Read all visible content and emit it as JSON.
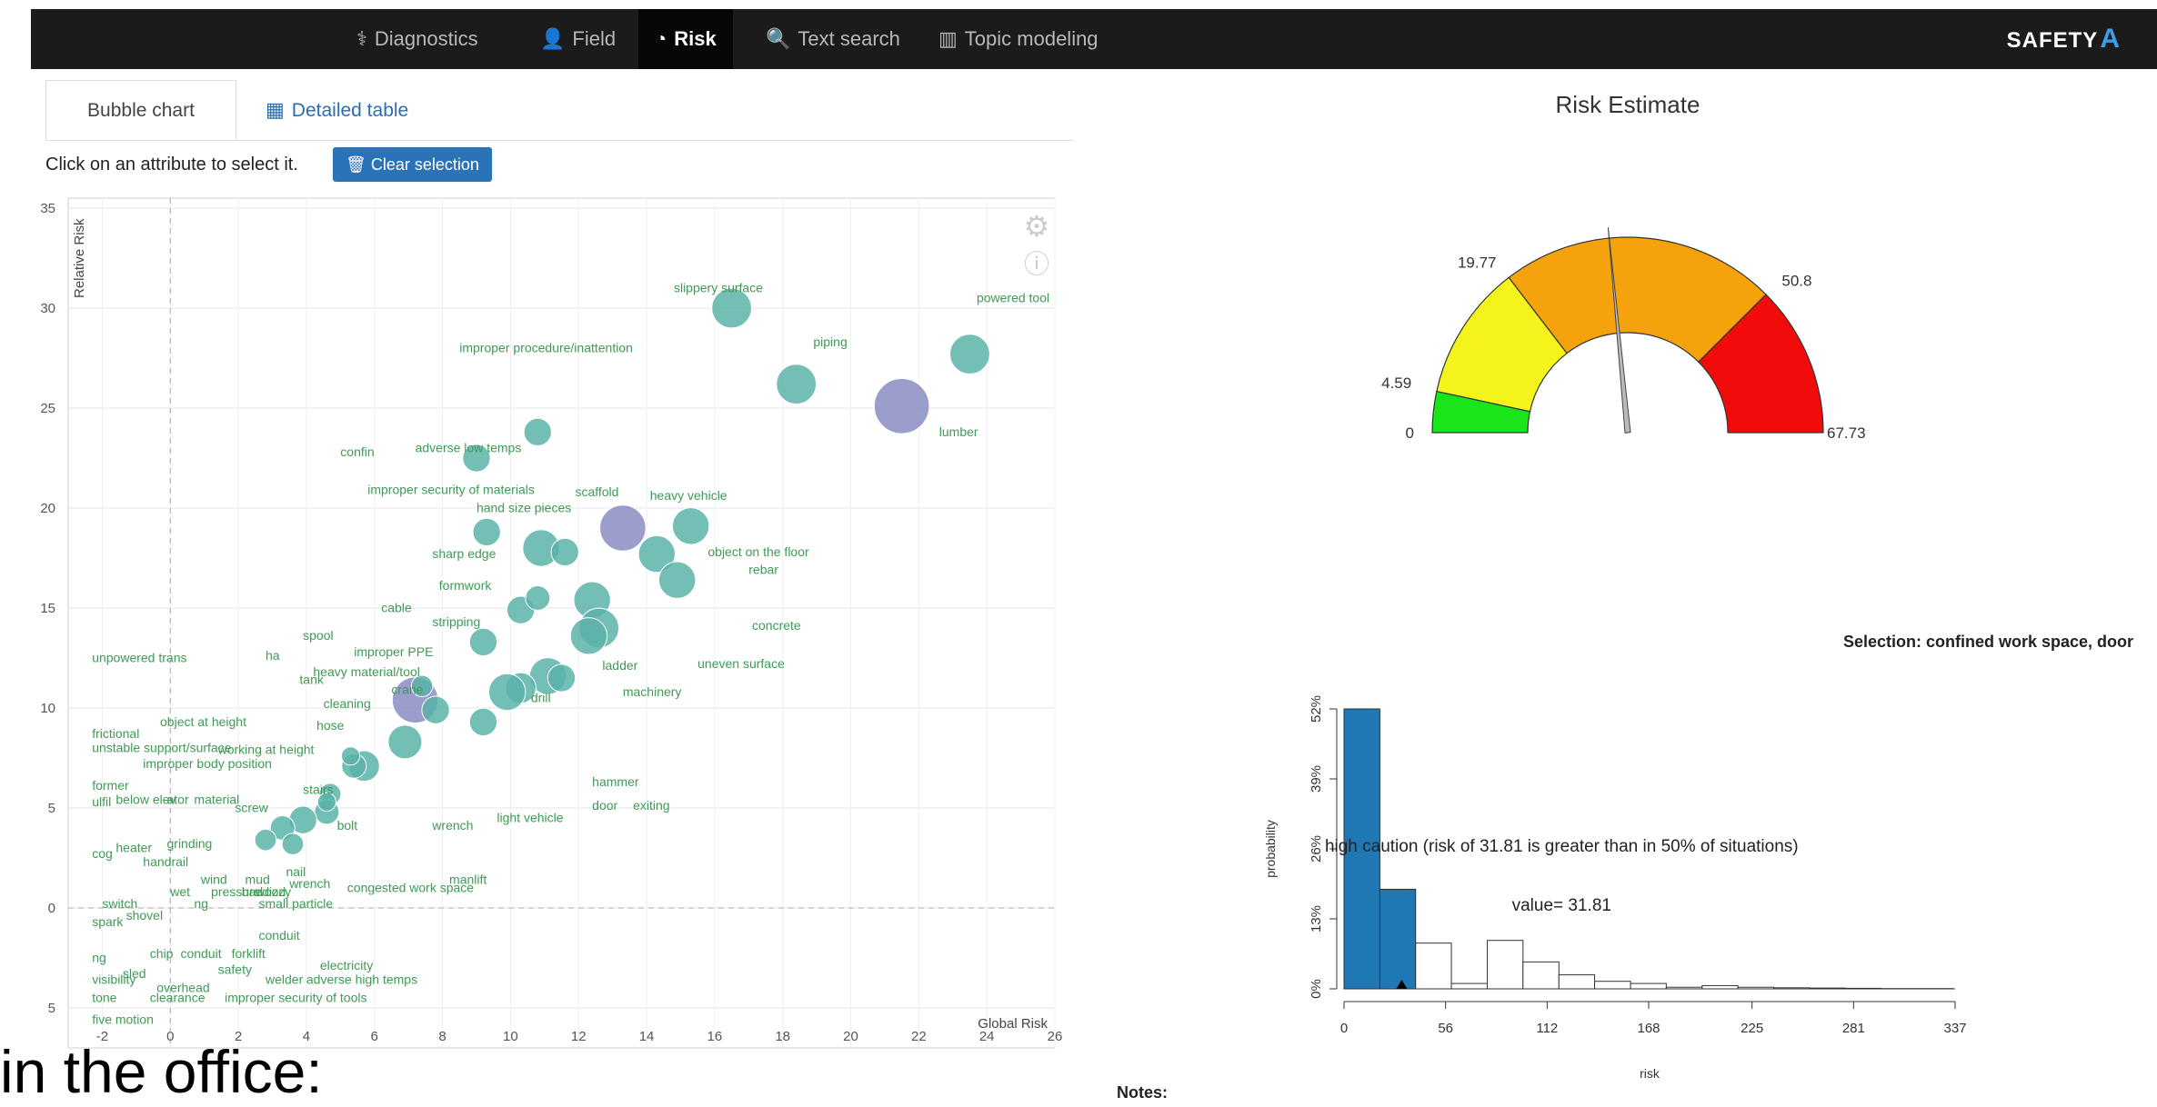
{
  "nav": {
    "items": [
      {
        "label": "Diagnostics",
        "icon": "stethoscope-icon",
        "glyph": "⚕"
      },
      {
        "label": "Field",
        "icon": "user-icon",
        "glyph": "👤"
      },
      {
        "label": "Risk",
        "icon": "dashboard-icon",
        "glyph": "◔",
        "active": true
      },
      {
        "label": "Text search",
        "icon": "search-icon",
        "glyph": "🔍"
      },
      {
        "label": "Topic modeling",
        "icon": "bar-chart-icon",
        "glyph": "▥"
      }
    ],
    "brand": "SAFETY",
    "brand_mark": "A"
  },
  "tabs": [
    {
      "label": "Bubble chart",
      "active": true
    },
    {
      "label": "Detailed table",
      "icon": "table-icon",
      "glyph": "▦"
    }
  ],
  "hint": "Click on an attribute to select it.",
  "clear_button": {
    "label": "Clear selection",
    "glyph": "🗑"
  },
  "risk_title": "Risk Estimate",
  "selection_text": "Selection: confined work space, door",
  "notes_label": "Notes:",
  "overlay_text": "in the office:",
  "colors": {
    "bubble_teal": "#5bb3a8",
    "bubble_purple": "#8a8cc1",
    "label_green": "#3f9a56",
    "gauge_green": "#19e619",
    "gauge_yellow": "#f4f41c",
    "gauge_orange": "#f5a20c",
    "gauge_red": "#f20b0b",
    "hist_blue": "#1f77b4"
  },
  "chart_data": [
    {
      "type": "scatter",
      "xlabel": "Global Risk",
      "ylabel": "Relative Risk",
      "xlim": [
        -3,
        26
      ],
      "ylim": [
        -7,
        35.5
      ],
      "x_ticks": [
        -2,
        0,
        2,
        4,
        6,
        8,
        10,
        12,
        14,
        16,
        18,
        20,
        22,
        24,
        26
      ],
      "x_tick_labels": [
        "-2",
        "0",
        "2",
        "4",
        "6",
        "8",
        "10",
        "12",
        "14",
        "16",
        "18",
        "20",
        "22",
        "24",
        "26"
      ],
      "y_ticks": [
        35,
        30,
        25,
        20,
        15,
        10,
        5,
        0,
        -5
      ],
      "y_tick_labels": [
        "35",
        "30",
        "25",
        "20",
        "15",
        "10",
        "5",
        "0",
        "5"
      ],
      "points": [
        {
          "label": "slippery surface",
          "x": 16.5,
          "y": 30,
          "r": 1.3,
          "c": "teal"
        },
        {
          "label": "powered tool",
          "x": 23.5,
          "y": 27.7,
          "r": 1.3,
          "c": "teal"
        },
        {
          "label": "piping",
          "x": 18.4,
          "y": 26.2,
          "r": 1.3,
          "c": "teal"
        },
        {
          "label": "lumber",
          "x": 21.5,
          "y": 25.1,
          "r": 1.8,
          "c": "purple"
        },
        {
          "label": "improper procedure/inattention",
          "x": 10.8,
          "y": 23.8,
          "r": 0.9,
          "c": "teal"
        },
        {
          "label": "adverse low temps",
          "x": 9.0,
          "y": 22.5,
          "r": 0.9,
          "c": "teal"
        },
        {
          "label": "scaffold",
          "x": 13.3,
          "y": 19.0,
          "r": 1.5,
          "c": "purple"
        },
        {
          "label": "heavy vehicle",
          "x": 15.3,
          "y": 19.1,
          "r": 1.2,
          "c": "teal"
        },
        {
          "label": "object on the floor",
          "x": 14.3,
          "y": 17.7,
          "r": 1.2,
          "c": "teal"
        },
        {
          "label": "rebar",
          "x": 14.9,
          "y": 16.4,
          "r": 1.2,
          "c": "teal"
        },
        {
          "label": "improper security of materials",
          "x": 9.3,
          "y": 18.8,
          "r": 0.9,
          "c": "teal"
        },
        {
          "label": "hand size pieces",
          "x": 10.9,
          "y": 18.0,
          "r": 1.2,
          "c": "teal"
        },
        {
          "label": "sharp edge",
          "x": 11.6,
          "y": 17.8,
          "r": 0.9,
          "c": "teal"
        },
        {
          "label": "concrete",
          "x": 12.4,
          "y": 15.4,
          "r": 1.2,
          "c": "teal"
        },
        {
          "label": "formwork",
          "x": 10.3,
          "y": 14.9,
          "r": 0.9,
          "c": "teal"
        },
        {
          "label": "cable",
          "x": 10.8,
          "y": 15.5,
          "r": 0.8,
          "c": "teal"
        },
        {
          "label": "ladder",
          "x": 12.6,
          "y": 14.0,
          "r": 1.3,
          "c": "teal"
        },
        {
          "label": "uneven surface",
          "x": 12.3,
          "y": 13.6,
          "r": 1.2,
          "c": "teal"
        },
        {
          "label": "stripping",
          "x": 9.2,
          "y": 13.3,
          "r": 0.9,
          "c": "teal"
        },
        {
          "label": "machinery",
          "x": 11.1,
          "y": 11.6,
          "r": 1.2,
          "c": "teal"
        },
        {
          "label": "drill",
          "x": 10.3,
          "y": 11.0,
          "r": 1.0,
          "c": "teal"
        },
        {
          "label": "hammer",
          "x": 9.9,
          "y": 10.8,
          "r": 1.2,
          "c": "teal"
        },
        {
          "label": "door",
          "x": 11.5,
          "y": 11.5,
          "r": 0.9,
          "c": "teal"
        },
        {
          "label": "exiting",
          "x": 9.2,
          "y": 9.3,
          "r": 0.9,
          "c": "teal"
        },
        {
          "label": "confined work space",
          "x": 7.2,
          "y": 10.4,
          "r": 1.5,
          "c": "purple"
        },
        {
          "label": "crane",
          "x": 7.8,
          "y": 9.9,
          "r": 0.9,
          "c": "teal"
        },
        {
          "label": "light vehicle",
          "x": 6.9,
          "y": 8.3,
          "r": 1.1,
          "c": "teal"
        },
        {
          "label": "heavy material/tool",
          "x": 7.4,
          "y": 11.1,
          "r": 0.7,
          "c": "teal"
        },
        {
          "label": "cleaning",
          "x": 5.7,
          "y": 7.1,
          "r": 1.0,
          "c": "teal"
        },
        {
          "label": "wrench",
          "x": 5.4,
          "y": 7.1,
          "r": 0.8,
          "c": "teal"
        },
        {
          "label": "stairs",
          "x": 4.7,
          "y": 5.7,
          "r": 0.7,
          "c": "teal"
        },
        {
          "label": "bolt",
          "x": 4.6,
          "y": 4.8,
          "r": 0.8,
          "c": "teal"
        },
        {
          "label": "nail",
          "x": 3.9,
          "y": 4.4,
          "r": 0.9,
          "c": "teal"
        },
        {
          "label": "screw",
          "x": 3.3,
          "y": 4.0,
          "r": 0.8,
          "c": "teal"
        },
        {
          "label": "grinding",
          "x": 2.8,
          "y": 3.4,
          "r": 0.7,
          "c": "teal"
        },
        {
          "label": "mud",
          "x": 3.6,
          "y": 3.2,
          "r": 0.7,
          "c": "teal"
        },
        {
          "label": "working at height",
          "x": 5.3,
          "y": 7.6,
          "r": 0.6,
          "c": "teal"
        },
        {
          "label": "object at height",
          "x": 4.6,
          "y": 5.3,
          "r": 0.6,
          "c": "teal"
        }
      ],
      "small_labels": [
        {
          "text": "slippery surface",
          "x": 14.8,
          "y": 30.8
        },
        {
          "text": "powered tool",
          "x": 23.7,
          "y": 30.3
        },
        {
          "text": "piping",
          "x": 18.9,
          "y": 28.1
        },
        {
          "text": "lumber",
          "x": 22.6,
          "y": 23.6
        },
        {
          "text": "improper procedure/inattention",
          "x": 8.5,
          "y": 27.8
        },
        {
          "text": "confin",
          "x": 5.0,
          "y": 22.6
        },
        {
          "text": "adverse low temps",
          "x": 7.2,
          "y": 22.8
        },
        {
          "text": "improper security of materials",
          "x": 5.8,
          "y": 20.7
        },
        {
          "text": "hand size pieces",
          "x": 9.0,
          "y": 19.8
        },
        {
          "text": "scaffold",
          "x": 11.9,
          "y": 20.6
        },
        {
          "text": "heavy vehicle",
          "x": 14.1,
          "y": 20.4
        },
        {
          "text": "sharp edge",
          "x": 7.7,
          "y": 17.5
        },
        {
          "text": "object on the floor",
          "x": 15.8,
          "y": 17.6
        },
        {
          "text": "rebar",
          "x": 17.0,
          "y": 16.7
        },
        {
          "text": "formwork",
          "x": 7.9,
          "y": 15.9
        },
        {
          "text": "cable",
          "x": 6.2,
          "y": 14.8
        },
        {
          "text": "stripping",
          "x": 7.7,
          "y": 14.1
        },
        {
          "text": "concrete",
          "x": 17.1,
          "y": 13.9
        },
        {
          "text": "spool",
          "x": 3.9,
          "y": 13.4
        },
        {
          "text": "improper PPE",
          "x": 5.4,
          "y": 12.6
        },
        {
          "text": "unpowered trans",
          "x": -2.3,
          "y": 12.3
        },
        {
          "text": "ha",
          "x": 2.8,
          "y": 12.4
        },
        {
          "text": "tank",
          "x": 3.8,
          "y": 11.2
        },
        {
          "text": "heavy material/tool",
          "x": 4.2,
          "y": 11.6
        },
        {
          "text": "ladder",
          "x": 12.7,
          "y": 11.9
        },
        {
          "text": "uneven surface",
          "x": 15.5,
          "y": 12.0
        },
        {
          "text": "crane",
          "x": 6.5,
          "y": 10.7
        },
        {
          "text": "machinery",
          "x": 13.3,
          "y": 10.6
        },
        {
          "text": "drill",
          "x": 10.6,
          "y": 10.3
        },
        {
          "text": "cleaning",
          "x": 4.5,
          "y": 10.0
        },
        {
          "text": "object at height",
          "x": -0.3,
          "y": 9.1
        },
        {
          "text": "hose",
          "x": 4.3,
          "y": 8.9
        },
        {
          "text": "frictional",
          "x": -2.3,
          "y": 8.5
        },
        {
          "text": "unstable support/surface",
          "x": -2.3,
          "y": 7.8
        },
        {
          "text": "working at height",
          "x": 1.4,
          "y": 7.7
        },
        {
          "text": "improper body position",
          "x": -0.8,
          "y": 7.0
        },
        {
          "text": "former",
          "x": -2.3,
          "y": 5.9
        },
        {
          "text": "stairs",
          "x": 3.9,
          "y": 5.7
        },
        {
          "text": "ulfil",
          "x": -2.3,
          "y": 5.1
        },
        {
          "text": "below elev",
          "x": -1.6,
          "y": 5.2
        },
        {
          "text": "ator",
          "x": -0.1,
          "y": 5.2
        },
        {
          "text": "material",
          "x": 0.7,
          "y": 5.2
        },
        {
          "text": "screw",
          "x": 1.9,
          "y": 4.8
        },
        {
          "text": "hammer",
          "x": 12.4,
          "y": 6.1
        },
        {
          "text": "exiting",
          "x": 13.6,
          "y": 4.9
        },
        {
          "text": "door",
          "x": 12.4,
          "y": 4.9
        },
        {
          "text": "light vehicle",
          "x": 9.6,
          "y": 4.3
        },
        {
          "text": "wrench",
          "x": 7.7,
          "y": 3.9
        },
        {
          "text": "bolt",
          "x": 4.9,
          "y": 3.9
        },
        {
          "text": "cog",
          "x": -2.3,
          "y": 2.5
        },
        {
          "text": "heater",
          "x": -1.6,
          "y": 2.8
        },
        {
          "text": "grinding",
          "x": -0.1,
          "y": 3.0
        },
        {
          "text": "handrail",
          "x": -0.8,
          "y": 2.1
        },
        {
          "text": "nail",
          "x": 3.4,
          "y": 1.6
        },
        {
          "text": "wind",
          "x": 0.9,
          "y": 1.2
        },
        {
          "text": "mud",
          "x": 2.2,
          "y": 1.2
        },
        {
          "text": "wet",
          "x": 0.0,
          "y": 0.6
        },
        {
          "text": "pressure",
          "x": 1.2,
          "y": 0.6
        },
        {
          "text": "bad",
          "x": 2.1,
          "y": 0.6
        },
        {
          "text": "wood",
          "x": 2.5,
          "y": 0.6
        },
        {
          "text": "dizzy",
          "x": 2.7,
          "y": 0.6
        },
        {
          "text": "wrench",
          "x": 3.5,
          "y": 1.0
        },
        {
          "text": "congested work space",
          "x": 5.2,
          "y": 0.8
        },
        {
          "text": "manlift",
          "x": 8.2,
          "y": 1.2
        },
        {
          "text": "switch",
          "x": -2.0,
          "y": 0.0
        },
        {
          "text": "ng",
          "x": 0.7,
          "y": 0.0
        },
        {
          "text": "small particle",
          "x": 2.6,
          "y": 0.0
        },
        {
          "text": "spark",
          "x": -2.3,
          "y": -0.9
        },
        {
          "text": "shovel",
          "x": -1.3,
          "y": -0.6
        },
        {
          "text": "conduit",
          "x": 2.6,
          "y": -1.6
        },
        {
          "text": "ng",
          "x": -2.3,
          "y": -2.7
        },
        {
          "text": "chip",
          "x": -0.6,
          "y": -2.5
        },
        {
          "text": "conduit",
          "x": 0.3,
          "y": -2.5
        },
        {
          "text": "forklift",
          "x": 1.8,
          "y": -2.5
        },
        {
          "text": "electricity",
          "x": 4.4,
          "y": -3.1
        },
        {
          "text": "visibility",
          "x": -2.3,
          "y": -3.8
        },
        {
          "text": "sled",
          "x": -1.4,
          "y": -3.5
        },
        {
          "text": "safety",
          "x": 1.4,
          "y": -3.3
        },
        {
          "text": "overhead",
          "x": -0.4,
          "y": -4.2
        },
        {
          "text": "welder",
          "x": 2.8,
          "y": -3.8
        },
        {
          "text": "adverse high temps",
          "x": 4.0,
          "y": -3.8
        },
        {
          "text": "tone",
          "x": -2.3,
          "y": -4.7
        },
        {
          "text": "clearance",
          "x": -0.6,
          "y": -4.7
        },
        {
          "text": "improper security of tools",
          "x": 1.6,
          "y": -4.7
        },
        {
          "text": "five motion",
          "x": -2.3,
          "y": -5.8
        }
      ]
    },
    {
      "type": "gauge",
      "min": 0,
      "max": 67.73,
      "value": 31.81,
      "bands": [
        {
          "from": 0,
          "to": 4.59,
          "color": "green"
        },
        {
          "from": 4.59,
          "to": 19.77,
          "color": "yellow"
        },
        {
          "from": 19.77,
          "to": 50.8,
          "color": "orange"
        },
        {
          "from": 50.8,
          "to": 67.73,
          "color": "red"
        }
      ],
      "labels": [
        "0",
        "4.59",
        "19.77",
        "50.8",
        "67.73"
      ]
    },
    {
      "type": "bar",
      "xlabel": "risk",
      "ylabel": "probability",
      "x_ticks": [
        0,
        56,
        112,
        168,
        225,
        281,
        337
      ],
      "x_tick_labels": [
        "0",
        "56",
        "112",
        "168",
        "225",
        "281",
        "337"
      ],
      "y_ticks": [
        0,
        13,
        26,
        39,
        52
      ],
      "y_tick_labels": [
        "0%",
        "13%",
        "26%",
        "39%",
        "52%"
      ],
      "bins": [
        {
          "from": 0,
          "to": 19.77,
          "value": 52,
          "highlight": true
        },
        {
          "from": 19.77,
          "to": 39.5,
          "value": 18.5,
          "highlight": true
        },
        {
          "from": 39.5,
          "to": 59.2,
          "value": 8.5
        },
        {
          "from": 59.2,
          "to": 79.0,
          "value": 1.0
        },
        {
          "from": 79.0,
          "to": 98.7,
          "value": 9.0
        },
        {
          "from": 98.7,
          "to": 118.5,
          "value": 5.0
        },
        {
          "from": 118.5,
          "to": 138.2,
          "value": 2.6
        },
        {
          "from": 138.2,
          "to": 158.0,
          "value": 1.4
        },
        {
          "from": 158.0,
          "to": 177.7,
          "value": 1.0
        },
        {
          "from": 177.7,
          "to": 197.5,
          "value": 0.3
        },
        {
          "from": 197.5,
          "to": 217.2,
          "value": 0.6
        },
        {
          "from": 217.2,
          "to": 237.0,
          "value": 0.3
        },
        {
          "from": 237.0,
          "to": 256.7,
          "value": 0.2
        },
        {
          "from": 256.7,
          "to": 276.5,
          "value": 0.15
        },
        {
          "from": 276.5,
          "to": 296.2,
          "value": 0.1
        },
        {
          "from": 296.2,
          "to": 316.0,
          "value": 0.05
        },
        {
          "from": 316.0,
          "to": 335.7,
          "value": 0.05
        }
      ],
      "marker_value": 31.81,
      "annotation": "high caution (risk of 31.81 is greater than in 50% of situations)",
      "value_text": "value= 31.81"
    }
  ]
}
